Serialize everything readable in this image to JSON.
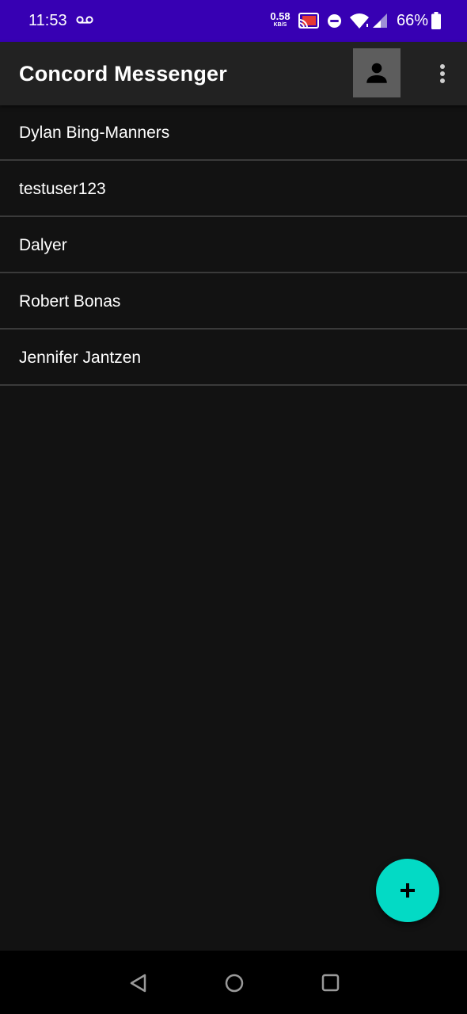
{
  "status_bar": {
    "time": "11:53",
    "net_speed_value": "0.58",
    "net_speed_unit": "KB/S",
    "battery_percent": "66%",
    "icons": [
      "voicemail-icon",
      "cast-icon",
      "do-not-disturb-icon",
      "wifi-icon",
      "cell-signal-icon",
      "battery-icon"
    ]
  },
  "app_bar": {
    "title": "Concord Messenger",
    "profile_icon": "person-icon",
    "menu_icon": "more-vert-icon"
  },
  "contacts": [
    {
      "name": "Dylan Bing-Manners"
    },
    {
      "name": "testuser123"
    },
    {
      "name": "Dalyer"
    },
    {
      "name": "Robert Bonas"
    },
    {
      "name": "Jennifer Jantzen"
    }
  ],
  "fab": {
    "icon": "plus-icon"
  },
  "nav_bar": {
    "icons": [
      "back-icon",
      "home-icon",
      "recents-icon"
    ]
  },
  "colors": {
    "status_bar": "#3700b3",
    "app_bar": "#222222",
    "background": "#121212",
    "fab": "#03dac5",
    "divider": "#3a3a3a"
  }
}
